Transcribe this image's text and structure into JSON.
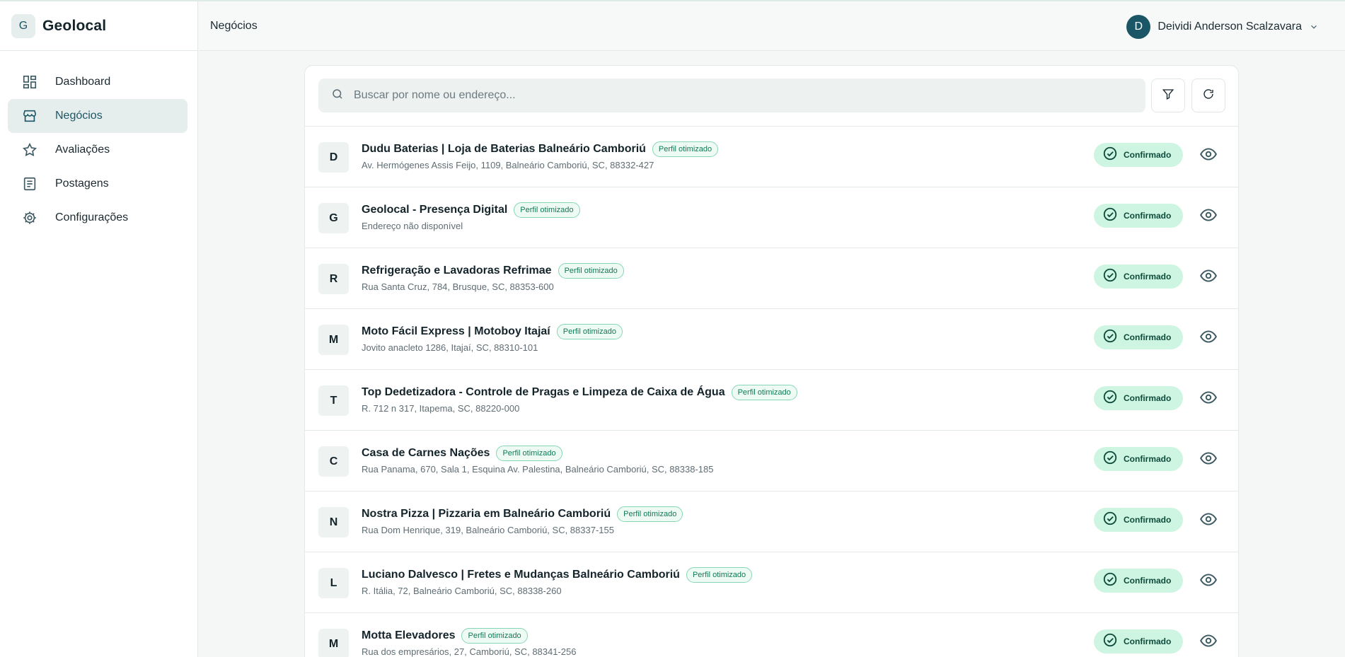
{
  "brand": {
    "logo_letter": "G",
    "name": "Geolocal"
  },
  "nav": [
    {
      "label": "Dashboard",
      "icon": "dashboard-icon",
      "active": false
    },
    {
      "label": "Negócios",
      "icon": "store-icon",
      "active": true
    },
    {
      "label": "Avaliações",
      "icon": "star-icon",
      "active": false
    },
    {
      "label": "Postagens",
      "icon": "document-icon",
      "active": false
    },
    {
      "label": "Configurações",
      "icon": "gear-icon",
      "active": false
    }
  ],
  "header": {
    "title": "Negócios",
    "user": {
      "initial": "D",
      "name": "Deividi Anderson Scalzavara"
    }
  },
  "search": {
    "placeholder": "Buscar por nome ou endereço...",
    "value": ""
  },
  "businesses": [
    {
      "letter": "D",
      "name": "Dudu Baterias | Loja de Baterias Balneário Camboriú",
      "badge": "Perfil otimizado",
      "address": "Av. Hermógenes Assis Feijo, 1109, Balneário Camboriú, SC, 88332-427",
      "status": "Confirmado"
    },
    {
      "letter": "G",
      "name": "Geolocal - Presença Digital",
      "badge": "Perfil otimizado",
      "address": "Endereço não disponível",
      "status": "Confirmado"
    },
    {
      "letter": "R",
      "name": "Refrigeração e Lavadoras Refrimae",
      "badge": "Perfil otimizado",
      "address": "Rua Santa Cruz, 784, Brusque, SC, 88353-600",
      "status": "Confirmado"
    },
    {
      "letter": "M",
      "name": "Moto Fácil Express | Motoboy Itajaí",
      "badge": "Perfil otimizado",
      "address": "Jovito anacleto 1286, Itajaí, SC, 88310-101",
      "status": "Confirmado"
    },
    {
      "letter": "T",
      "name": "Top Dedetizadora - Controle de Pragas e Limpeza de Caixa de Água",
      "badge": "Perfil otimizado",
      "address": "R. 712 n 317, Itapema, SC, 88220-000",
      "status": "Confirmado"
    },
    {
      "letter": "C",
      "name": "Casa de Carnes Nações",
      "badge": "Perfil otimizado",
      "address": "Rua Panama, 670, Sala 1, Esquina Av. Palestina, Balneário Camboriú, SC, 88338-185",
      "status": "Confirmado"
    },
    {
      "letter": "N",
      "name": "Nostra Pizza | Pizzaria em Balneário Camboriú",
      "badge": "Perfil otimizado",
      "address": "Rua Dom Henrique, 319, Balneário Camboriú, SC, 88337-155",
      "status": "Confirmado"
    },
    {
      "letter": "L",
      "name": "Luciano Dalvesco | Fretes e Mudanças Balneário Camboriú",
      "badge": "Perfil otimizado",
      "address": "R. Itália, 72, Balneário Camboriú, SC, 88338-260",
      "status": "Confirmado"
    },
    {
      "letter": "M",
      "name": "Motta Elevadores",
      "badge": "Perfil otimizado",
      "address": "Rua dos empresários, 27, Camboriú, SC, 88341-256",
      "status": "Confirmado"
    }
  ],
  "colors": {
    "accent": "#1b5666",
    "status_bg": "#cdf5e2",
    "badge_text": "#0f7a55"
  }
}
